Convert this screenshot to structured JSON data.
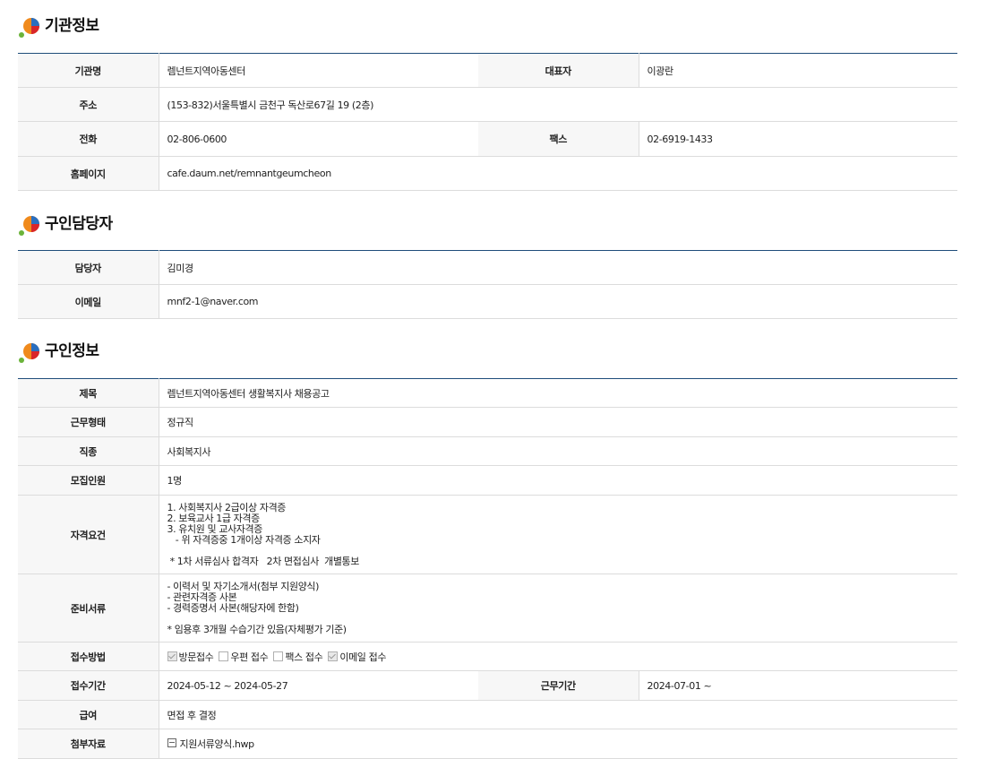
{
  "sections": {
    "org": {
      "title": "기관정보",
      "rows": {
        "name_label": "기관명",
        "name": "렘넌트지역아동센터",
        "ceo_label": "대표자",
        "ceo": "이광란",
        "addr_label": "주소",
        "addr": "(153-832)서울특별시 금천구 독산로67길 19 (2층)",
        "tel_label": "전화",
        "tel": "02-806-0600",
        "fax_label": "팩스",
        "fax": "02-6919-1433",
        "web_label": "홈페이지",
        "web": "cafe.daum.net/remnantgeumcheon"
      }
    },
    "contact": {
      "title": "구인담당자",
      "rows": {
        "person_label": "담당자",
        "person": "김미경",
        "email_label": "이메일",
        "email": "mnf2-1@naver.com"
      }
    },
    "job": {
      "title": "구인정보",
      "rows": {
        "subject_label": "제목",
        "subject": "렘넌트지역아동센터 생활복지사 채용공고",
        "type_label": "근무형태",
        "type": "정규직",
        "job_label": "직종",
        "job": "사회복지사",
        "count_label": "모집인원",
        "count": "1명",
        "qual_label": "자격요건",
        "qual": "1. 사회복지사 2급이상 자격증\n2. 보육교사 1급 자격증\n3. 유치원 및 교사자격증\n   - 위 자격증중 1개이상 자격증 소지자\n\n * 1차 서류심사 합격자   2차 면접심사  개별통보",
        "docs_label": "준비서류",
        "docs": "- 이력서 및 자기소개서(첨부 지원양식)\n- 관련자격증 사본\n- 경력증명서 사본(해당자에 한함)\n\n* 임용후 3개월 수습기간 있음(자체평가 기준)",
        "method_label": "접수방법",
        "methods": [
          {
            "label": "방문접수",
            "checked": true
          },
          {
            "label": "우편 접수",
            "checked": false
          },
          {
            "label": "팩스 접수",
            "checked": false
          },
          {
            "label": "이메일 접수",
            "checked": true
          }
        ],
        "period_label": "접수기간",
        "period": "2024-05-12 ~ 2024-05-27",
        "work_label": "근무기간",
        "work": "2024-07-01 ~",
        "pay_label": "급여",
        "pay": "면접 후 결정",
        "file_label": "첨부자료",
        "file": "지원서류양식.hwp"
      }
    }
  },
  "icon": "logo-icon",
  "colors": {
    "header_line": "#1f4d7a",
    "th_bg": "#f7f7f7",
    "border": "#dcdcdc"
  }
}
